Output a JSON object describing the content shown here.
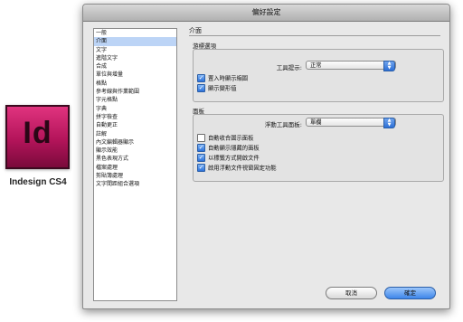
{
  "product": {
    "logo_text": "Id",
    "name": "Indesign CS4"
  },
  "window": {
    "title": "偏好設定"
  },
  "sidebar": {
    "items": [
      {
        "label": "一般",
        "selected": false
      },
      {
        "label": "介面",
        "selected": true
      },
      {
        "label": "文字",
        "selected": false
      },
      {
        "label": "進階文字",
        "selected": false
      },
      {
        "label": "合成",
        "selected": false
      },
      {
        "label": "單位與增量",
        "selected": false
      },
      {
        "label": "格點",
        "selected": false
      },
      {
        "label": "參考線與作業範圍",
        "selected": false
      },
      {
        "label": "字元格點",
        "selected": false
      },
      {
        "label": "字典",
        "selected": false
      },
      {
        "label": "拼字檢查",
        "selected": false
      },
      {
        "label": "自動更正",
        "selected": false
      },
      {
        "label": "註解",
        "selected": false
      },
      {
        "label": "內文編輯器顯示",
        "selected": false
      },
      {
        "label": "顯示效能",
        "selected": false
      },
      {
        "label": "黑色表現方式",
        "selected": false
      },
      {
        "label": "檔案處理",
        "selected": false
      },
      {
        "label": "剪貼簿處理",
        "selected": false
      },
      {
        "label": "文字間距組合選項",
        "selected": false
      }
    ]
  },
  "main": {
    "section_title": "介面",
    "cursor_options": {
      "group_label": "游標選項",
      "tool_tips_label": "工具提示:",
      "tool_tips_value": "正常",
      "checkboxes": [
        {
          "label": "置入時顯示縮圖",
          "checked": true
        },
        {
          "label": "顯示變形值",
          "checked": true
        }
      ]
    },
    "panels": {
      "group_label": "面板",
      "floating_tools_label": "浮動工具面板:",
      "floating_tools_value": "單欄",
      "checkboxes": [
        {
          "label": "自動收合圖示面板",
          "checked": false
        },
        {
          "label": "自動顯示隱藏的面板",
          "checked": true
        },
        {
          "label": "以標籤方式開啟文件",
          "checked": true
        },
        {
          "label": "啟用浮動文件視窗固定功能",
          "checked": true
        }
      ]
    }
  },
  "buttons": {
    "cancel": "取消",
    "ok": "確定"
  },
  "colors": {
    "accent": "#3d86ea",
    "selection": "#bcd4f6",
    "logo": "#b3145a"
  }
}
